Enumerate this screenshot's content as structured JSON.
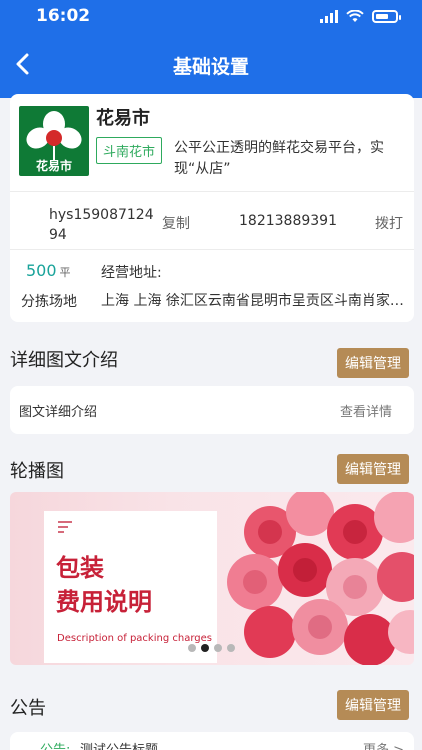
{
  "status_bar": {
    "time": "16:02"
  },
  "nav": {
    "title": "基础设置"
  },
  "shop": {
    "logo_text": "花易市",
    "name": "花易市",
    "market_tag": "斗南花市",
    "slogan": "公平公正透明的鲜花交易平台，实现“从店”",
    "account": "hys15908712494",
    "copy_label": "复制",
    "phone": "18213889391",
    "dial_label": "拨打",
    "area_value": "500",
    "area_unit": "平",
    "area_label": "分拣场地",
    "address_label": "经营地址:",
    "address": "上海 上海 徐汇区云南省昆明市呈贡区斗南肖家…"
  },
  "detail_section": {
    "title": "详细图文介绍",
    "edit_label": "编辑管理",
    "row_label": "图文详细介绍",
    "row_action": "查看详情"
  },
  "carousel_section": {
    "title": "轮播图",
    "edit_label": "编辑管理",
    "banner_line1": "包装",
    "banner_line2": "费用说明",
    "banner_en": "Description of packing charges",
    "slide_count": 4,
    "active_slide": 2
  },
  "notice_section": {
    "title": "公告",
    "edit_label": "编辑管理",
    "notice_label": "公告:",
    "notice_text": "测试公告标题",
    "more_label": "更多 >"
  },
  "colors": {
    "primary": "#1f6fe8",
    "edit_button": "#b58b56",
    "tag_green": "#2eaa5d",
    "teal": "#19a39a",
    "banner_red": "#c72138"
  }
}
